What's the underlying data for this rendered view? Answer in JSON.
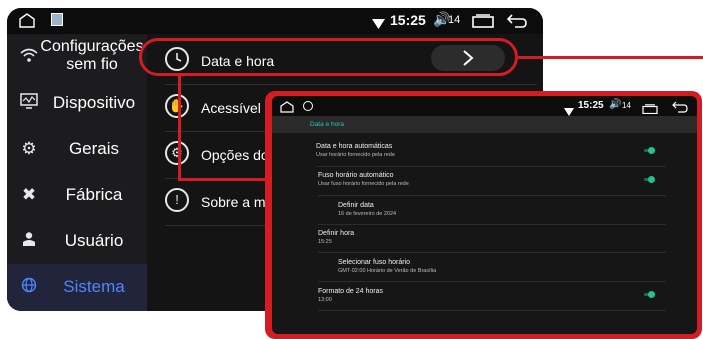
{
  "main": {
    "status": {
      "time": "15:25",
      "volume": "14"
    },
    "sidebar": [
      {
        "label": "Configurações sem fio",
        "label_line1": "Configurações",
        "label_line2": "sem fio",
        "icon": "wifi-icon"
      },
      {
        "label": "Dispositivo",
        "icon": "monitor-icon"
      },
      {
        "label": "Gerais",
        "icon": "gear-icon"
      },
      {
        "label": "Fábrica",
        "icon": "tools-icon"
      },
      {
        "label": "Usuário",
        "icon": "user-icon"
      },
      {
        "label": "Sistema",
        "icon": "globe-icon",
        "active": true
      }
    ],
    "menu": [
      {
        "label": "Data e hora",
        "icon": "clock-icon"
      },
      {
        "label": "Acessível",
        "icon": "hand-icon"
      },
      {
        "label": "Opções do",
        "icon": "options-gear-icon"
      },
      {
        "label": "Sobre a má",
        "icon": "info-icon"
      }
    ]
  },
  "inset": {
    "status": {
      "time": "15:25",
      "volume": "14"
    },
    "header": "Data e hora",
    "rows": [
      {
        "title": "Data e hora automáticas",
        "subtitle": "Usar horário fornecido pela rede",
        "toggle": true,
        "indent": false
      },
      {
        "title": "Fuso horário automático",
        "subtitle": "Usar fuso horário fornecido pela rede",
        "toggle": true,
        "indent": false
      },
      {
        "title": "Definir data",
        "subtitle": "16 de fevereiro de 2024",
        "toggle": false,
        "indent": true
      },
      {
        "title": "Definir hora",
        "subtitle": "15:25",
        "toggle": false,
        "indent": false
      },
      {
        "title": "Selecionar fuso horário",
        "subtitle": "GMT-02:00 Horário de Verão de Brasília",
        "toggle": false,
        "indent": true
      },
      {
        "title": "Formato de 24 horas",
        "subtitle": "13:00",
        "toggle": true,
        "indent": false
      }
    ]
  },
  "colors": {
    "accent": "#4d86ff",
    "highlight": "#d41c23",
    "toggle": "#23c28f",
    "header_text": "#27c4b3"
  }
}
